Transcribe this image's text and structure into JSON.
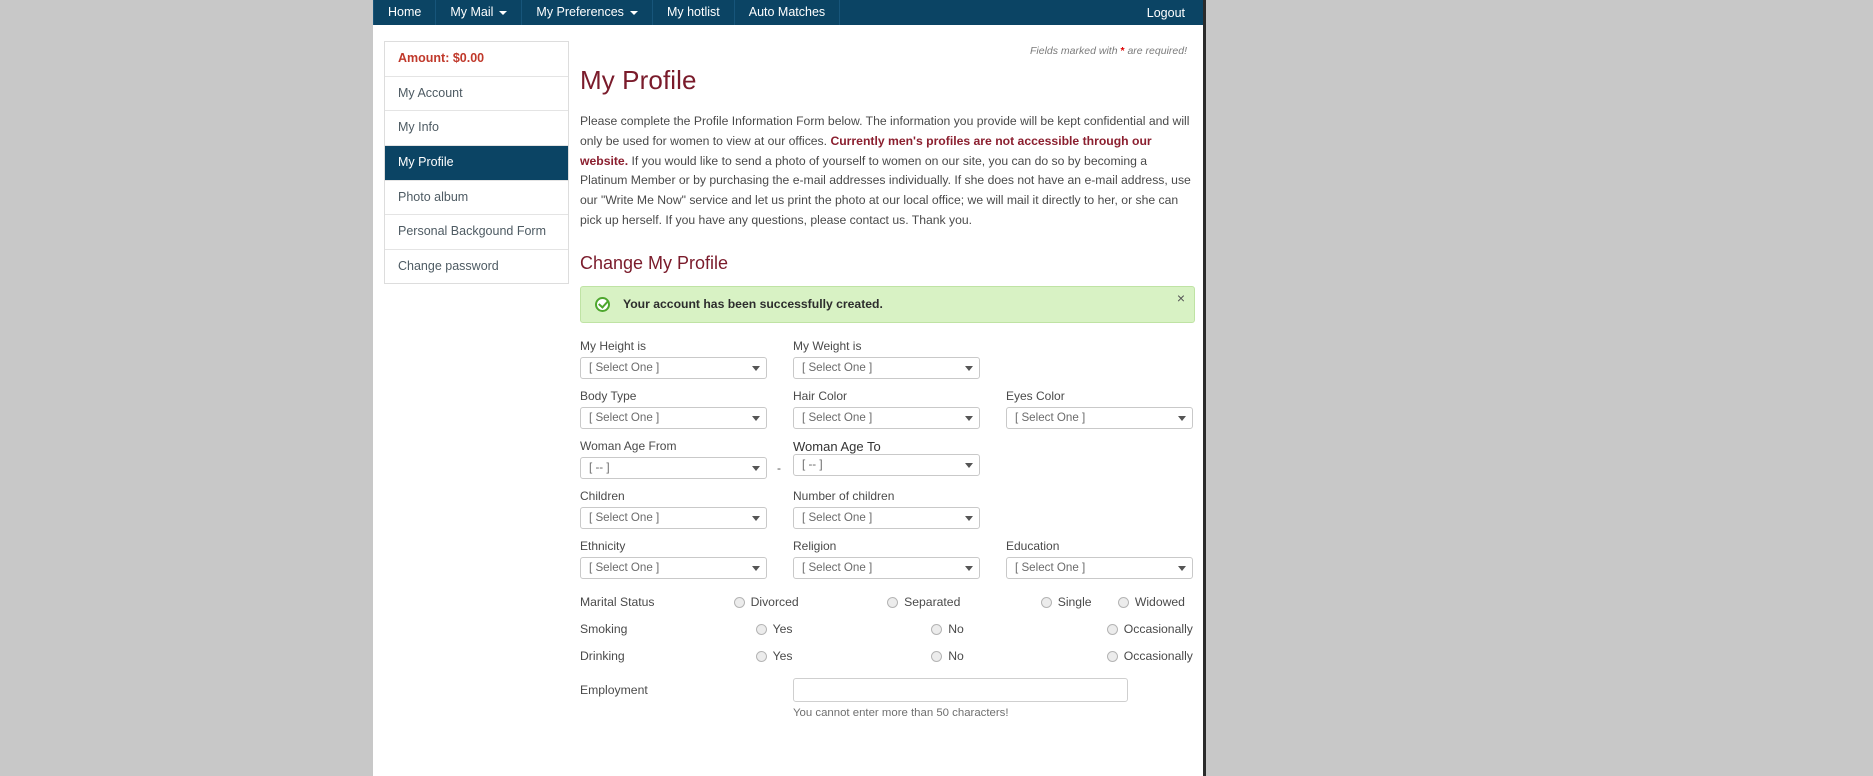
{
  "navbar": {
    "items": [
      {
        "label": "Home",
        "caret": false
      },
      {
        "label": "My Mail",
        "caret": true
      },
      {
        "label": "My Preferences",
        "caret": true
      },
      {
        "label": "My hotlist",
        "caret": false
      },
      {
        "label": "Auto Matches",
        "caret": false
      }
    ],
    "logout": "Logout"
  },
  "required_note": {
    "before": "Fields marked with ",
    "star": "*",
    "after": " are required!"
  },
  "sidebar": {
    "items": [
      {
        "label": "Amount: $0.00",
        "kind": "amount"
      },
      {
        "label": "My Account",
        "kind": "link"
      },
      {
        "label": "My Info",
        "kind": "link"
      },
      {
        "label": "My Profile",
        "kind": "active"
      },
      {
        "label": "Photo album",
        "kind": "link"
      },
      {
        "label": "Personal Backgound Form",
        "kind": "link"
      },
      {
        "label": "Change password",
        "kind": "link"
      }
    ]
  },
  "main": {
    "page_title": "My Profile",
    "intro_part1": "Please complete the Profile Information Form below. The information you provide will be kept confidential and will only be used for women to view at our offices. ",
    "intro_bold": "Currently men's profiles are not accessible through our website.",
    "intro_part2": " If you would like to send a photo of yourself to women on our site, you can do so by becoming a Platinum Member or by purchasing the e-mail addresses individually. If she does not have an e-mail address, use our \"Write Me Now\" service and let us print the photo at our local office; we will mail it directly to her, or she can pick up herself. If you have any questions, please contact us. Thank you.",
    "section_title": "Change My Profile",
    "alert": {
      "message": "Your account has been successfully created.",
      "close_label": "×",
      "icon": "check-circle-icon",
      "bg_color": "#d8f2c4",
      "border_color": "#bfe3a4"
    },
    "selects": {
      "height": {
        "label": "My Height is",
        "value": "[ Select One ]"
      },
      "weight": {
        "label": "My Weight is",
        "value": "[ Select One ]"
      },
      "body_type": {
        "label": "Body Type",
        "value": "[ Select One ]"
      },
      "hair_color": {
        "label": "Hair Color",
        "value": "[ Select One ]"
      },
      "eyes_color": {
        "label": "Eyes Color",
        "value": "[ Select One ]"
      },
      "age_from": {
        "label": "Woman Age From",
        "value": "[ -- ]"
      },
      "age_to": {
        "label": "Woman Age To",
        "value": "[ -- ]"
      },
      "children": {
        "label": "Children",
        "value": "[ Select One ]"
      },
      "num_children": {
        "label": "Number of children",
        "value": "[ Select One ]"
      },
      "ethnicity": {
        "label": "Ethnicity",
        "value": "[ Select One ]"
      },
      "religion": {
        "label": "Religion",
        "value": "[ Select One ]"
      },
      "education": {
        "label": "Education",
        "value": "[ Select One ]"
      }
    },
    "age_separator": "-",
    "radios": {
      "marital": {
        "label": "Marital Status",
        "options": [
          "Divorced",
          "Separated",
          "Single",
          "Widowed"
        ]
      },
      "smoking": {
        "label": "Smoking",
        "options": [
          "Yes",
          "No",
          "Occasionally"
        ]
      },
      "drinking": {
        "label": "Drinking",
        "options": [
          "Yes",
          "No",
          "Occasionally"
        ]
      }
    },
    "employment": {
      "label": "Employment",
      "value": "",
      "placeholder": "",
      "hint": "You cannot enter more than 50 characters!"
    }
  },
  "colors": {
    "nav_bg": "#0b4464",
    "heading": "#7a1b2b",
    "amount": "#c0392b",
    "alert_green": "#4ea72e"
  }
}
